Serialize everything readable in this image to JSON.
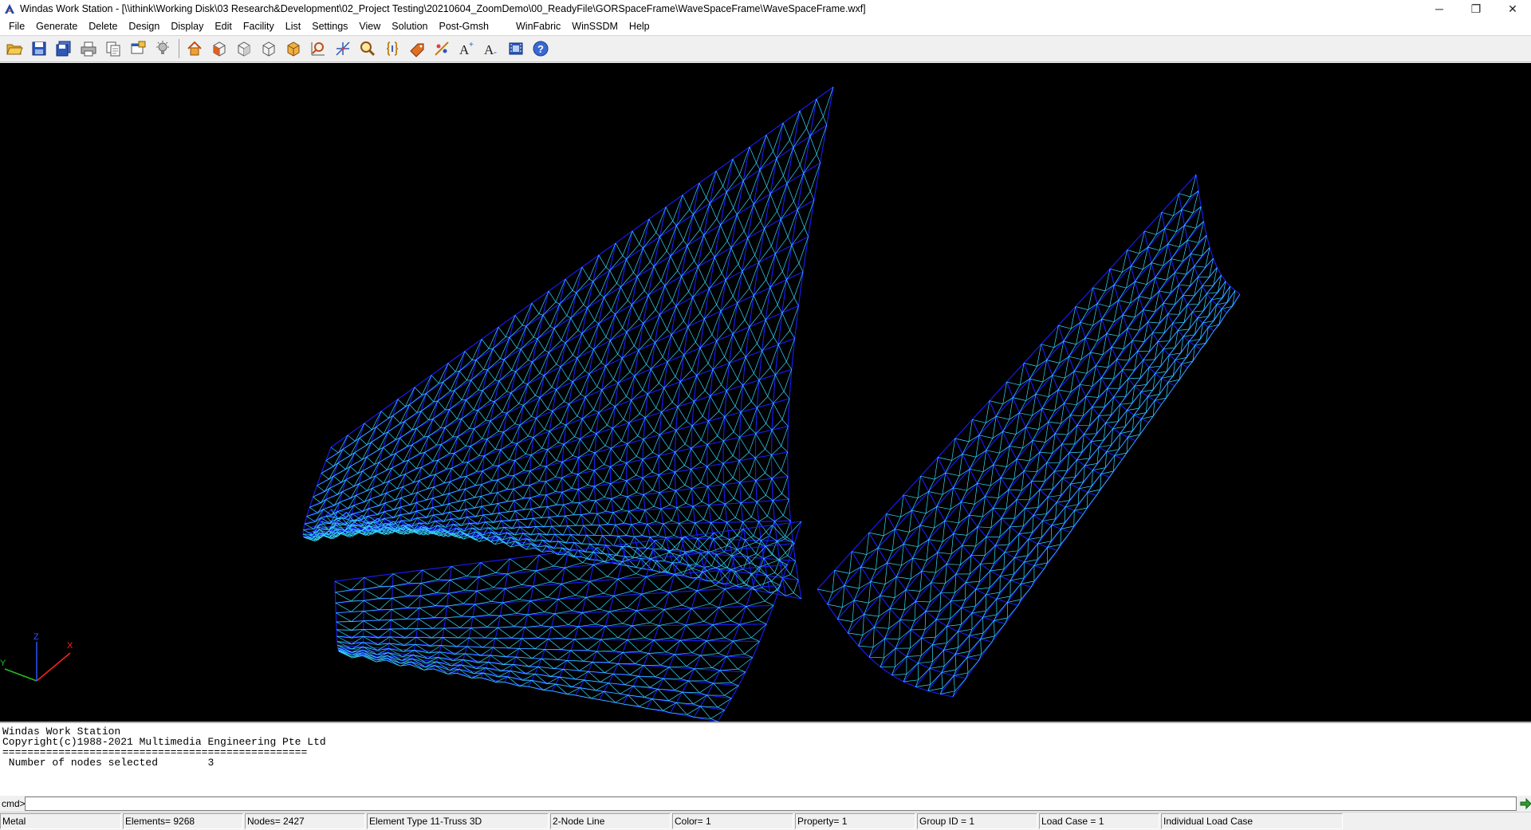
{
  "window": {
    "title": "Windas Work Station - [\\\\ithink\\Working Disk\\03 Research&Development\\02_Project Testing\\20210604_ZoomDemo\\00_ReadyFile\\GORSpaceFrame\\WaveSpaceFrame\\WaveSpaceFrame.wxf]",
    "minimize_glyph": "─",
    "restore_glyph": "❐",
    "close_glyph": "✕"
  },
  "menu": [
    "File",
    "Generate",
    "Delete",
    "Design",
    "Display",
    "Edit",
    "Facility",
    "List",
    "Settings",
    "View",
    "Solution",
    "Post-Gmsh",
    "WinFabric",
    "WinSSDM",
    "Help"
  ],
  "toolbar": {
    "icons": [
      "open-folder-icon",
      "save-icon",
      "save-all-icon",
      "print-icon",
      "copy-icon",
      "window-icon",
      "light-icon",
      "home-view-icon",
      "front-view-icon",
      "side-view-icon",
      "top-view-icon",
      "iso-view-icon",
      "zoom-fit-icon",
      "axis-icon",
      "zoom-icon",
      "braces-icon",
      "tag-icon",
      "node-tool-icon",
      "text-size-up-icon",
      "text-size-down-icon",
      "film-icon",
      "help-icon"
    ]
  },
  "viewport": {
    "background": "#000000",
    "mesh_colors": {
      "primary": "#1b1bff",
      "secondary": "#35d8ff"
    },
    "axes": {
      "x_label": "X",
      "y_label": "Y",
      "z_label": "Z",
      "x_color": "#ff2020",
      "y_color": "#20c020",
      "z_color": "#3050ff"
    }
  },
  "console": {
    "lines": [
      "Windas Work Station",
      "Copyright(c)1988-2021 Multimedia Engineering Pte Ltd",
      "=================================================",
      " Number of nodes selected        3"
    ]
  },
  "cmd": {
    "label": "cmd>",
    "value": ""
  },
  "status": {
    "material": "Metal",
    "elements": "Elements=  9268",
    "nodes": "Nodes=  2427",
    "element_type": "Element Type 11-Truss 3D",
    "node_line": "2-Node Line",
    "color": "Color= 1",
    "property": "Property= 1",
    "group": "Group ID =      1",
    "load_case": "Load Case =   1",
    "load_mode": "Individual Load Case"
  }
}
